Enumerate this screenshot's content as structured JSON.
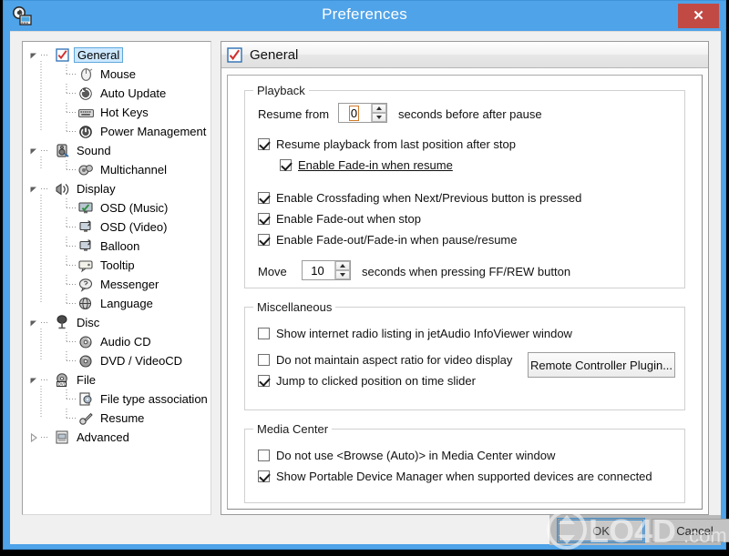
{
  "window": {
    "title": "Preferences",
    "icon": "app-preferences-icon",
    "close_label": "✕",
    "border_color": "#4fa3e8",
    "close_color": "#c24a44"
  },
  "sidebar": {
    "items": [
      {
        "label": "General",
        "level": 0,
        "expander": "open",
        "icon": "general-checkbox-icon",
        "selected": true
      },
      {
        "label": "Mouse",
        "level": 1,
        "expander": "none",
        "icon": "mouse-icon",
        "selected": false
      },
      {
        "label": "Auto Update",
        "level": 1,
        "expander": "none",
        "icon": "auto-update-icon",
        "selected": false
      },
      {
        "label": "Hot Keys",
        "level": 1,
        "expander": "none",
        "icon": "keyboard-icon",
        "selected": false
      },
      {
        "label": "Power Management",
        "level": 1,
        "expander": "none",
        "icon": "power-icon",
        "selected": false
      },
      {
        "label": "Sound",
        "level": 0,
        "expander": "open",
        "icon": "speaker-icon",
        "selected": false
      },
      {
        "label": "Multichannel",
        "level": 1,
        "expander": "none",
        "icon": "multichannel-icon",
        "selected": false
      },
      {
        "label": "Display",
        "level": 0,
        "expander": "open",
        "icon": "display-icon",
        "selected": false
      },
      {
        "label": "OSD (Music)",
        "level": 1,
        "expander": "none",
        "icon": "osd-music-icon",
        "selected": false
      },
      {
        "label": "OSD (Video)",
        "level": 1,
        "expander": "none",
        "icon": "osd-video-icon",
        "selected": false
      },
      {
        "label": "Balloon",
        "level": 1,
        "expander": "none",
        "icon": "balloon-icon",
        "selected": false
      },
      {
        "label": "Tooltip",
        "level": 1,
        "expander": "none",
        "icon": "tooltip-icon",
        "selected": false
      },
      {
        "label": "Messenger",
        "level": 1,
        "expander": "none",
        "icon": "messenger-icon",
        "selected": false
      },
      {
        "label": "Language",
        "level": 1,
        "expander": "none",
        "icon": "language-icon",
        "selected": false
      },
      {
        "label": "Disc",
        "level": 0,
        "expander": "open",
        "icon": "disc-icon",
        "selected": false
      },
      {
        "label": "Audio CD",
        "level": 1,
        "expander": "none",
        "icon": "audio-cd-icon",
        "selected": false
      },
      {
        "label": "DVD / VideoCD",
        "level": 1,
        "expander": "none",
        "icon": "dvd-icon",
        "selected": false
      },
      {
        "label": "File",
        "level": 0,
        "expander": "open",
        "icon": "file-dvd-icon",
        "selected": false
      },
      {
        "label": "File type association",
        "level": 1,
        "expander": "none",
        "icon": "file-assoc-icon",
        "selected": false
      },
      {
        "label": "Resume",
        "level": 1,
        "expander": "none",
        "icon": "resume-icon",
        "selected": false
      },
      {
        "label": "Advanced",
        "level": 0,
        "expander": "closed",
        "icon": "advanced-icon",
        "selected": false
      }
    ]
  },
  "page": {
    "header_title": "General",
    "header_icon": "general-checkbox-icon",
    "groups": {
      "playback": {
        "legend": "Playback",
        "resume_label_before": "Resume from",
        "resume_value": "0",
        "resume_label_after": "seconds before after pause",
        "checkboxes": [
          {
            "label": "Resume playback from last position after stop",
            "checked": true,
            "focused": false,
            "indent": 0
          },
          {
            "label": "Enable Fade-in when resume",
            "checked": true,
            "focused": true,
            "indent": 1
          },
          {
            "label": "Enable Crossfading when Next/Previous button is pressed",
            "checked": true,
            "focused": false,
            "indent": 0
          },
          {
            "label": "Enable Fade-out when stop",
            "checked": true,
            "focused": false,
            "indent": 0
          },
          {
            "label": "Enable Fade-out/Fade-in when pause/resume",
            "checked": true,
            "focused": false,
            "indent": 0
          }
        ],
        "move_label_before": "Move",
        "move_value": "10",
        "move_label_after": "seconds when pressing FF/REW button"
      },
      "miscellaneous": {
        "legend": "Miscellaneous",
        "checkboxes": [
          {
            "label": "Show internet radio listing in jetAudio InfoViewer window",
            "checked": false
          },
          {
            "label": "Do not maintain aspect ratio for video display",
            "checked": false
          },
          {
            "label": "Jump to clicked position on time slider",
            "checked": true
          }
        ],
        "button_label": "Remote Controller Plugin..."
      },
      "media_center": {
        "legend": "Media Center",
        "checkboxes": [
          {
            "label": "Do not use <Browse (Auto)> in Media Center window",
            "checked": false
          },
          {
            "label": "Show Portable Device Manager when supported devices are connected",
            "checked": true
          }
        ]
      }
    }
  },
  "footer": {
    "ok_label": "OK",
    "cancel_label": "Cancel"
  },
  "watermark": {
    "text": "LO4D",
    "suffix": ".com"
  }
}
